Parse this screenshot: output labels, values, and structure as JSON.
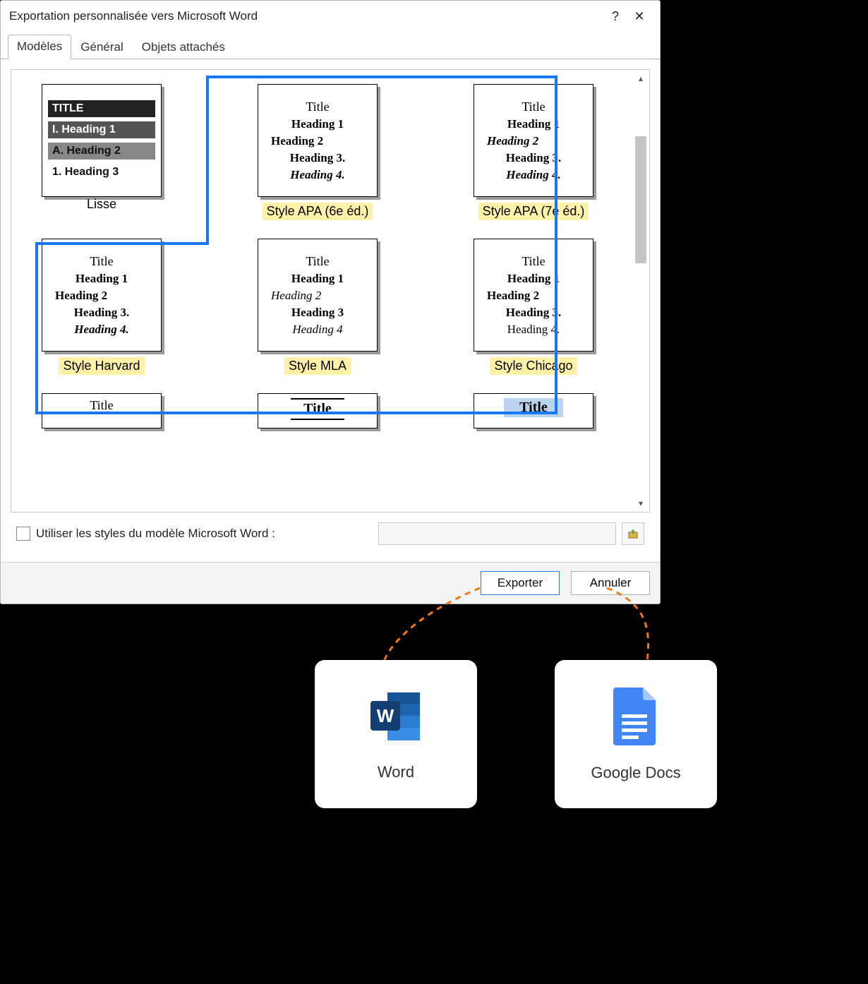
{
  "dialog": {
    "title": "Exportation personnalisée vers Microsoft Word",
    "help": "?",
    "close": "✕"
  },
  "tabs": {
    "models": "Modèles",
    "general": "Général",
    "attached": "Objets attachés"
  },
  "templates": {
    "lisse": {
      "label": "Lisse",
      "lines": {
        "title": "TITLE",
        "h1": "I. Heading 1",
        "h2": "A. Heading 2",
        "h3": "1. Heading 3"
      }
    },
    "apa6": {
      "label": "Style APA (6e éd.)",
      "lines": {
        "title": "Title",
        "h1": "Heading 1",
        "h2": "Heading 2",
        "h3": "Heading 3.",
        "h4": "Heading 4."
      }
    },
    "apa7": {
      "label": "Style APA (7e éd.)",
      "lines": {
        "title": "Title",
        "h1": "Heading 1",
        "h2": "Heading 2",
        "h3": "Heading 3.",
        "h4": "Heading 4."
      }
    },
    "harvard": {
      "label": "Style Harvard",
      "lines": {
        "title": "Title",
        "h1": "Heading 1",
        "h2": "Heading 2",
        "h3": "Heading 3.",
        "h4": "Heading 4."
      }
    },
    "mla": {
      "label": "Style MLA",
      "lines": {
        "title": "Title",
        "h1": "Heading 1",
        "h2": "Heading 2",
        "h3": "Heading 3",
        "h4": "Heading 4"
      }
    },
    "chicago": {
      "label": "Style Chicago",
      "lines": {
        "title": "Title",
        "h1": "Heading 1",
        "h2": "Heading 2",
        "h3": "Heading 3.",
        "h4": "Heading 4."
      }
    },
    "extra1": {
      "lines": {
        "title": "Title"
      }
    },
    "extra2": {
      "lines": {
        "title": "Title"
      }
    },
    "extra3": {
      "lines": {
        "title": "Title"
      }
    }
  },
  "checkrow": {
    "label": "Utiliser les styles du modèle Microsoft Word :"
  },
  "footer": {
    "export": "Exporter",
    "cancel": "Annuler"
  },
  "destinations": {
    "word": "Word",
    "gdocs": "Google Docs"
  }
}
